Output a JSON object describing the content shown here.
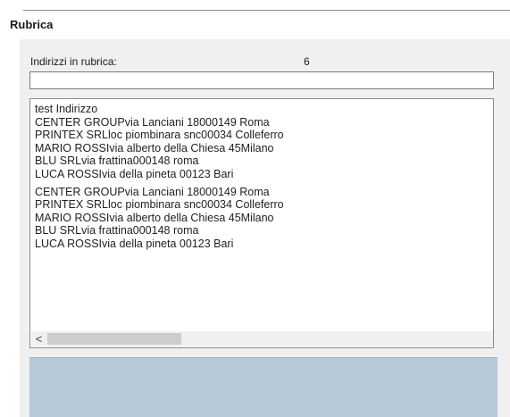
{
  "window": {
    "title": "Rubrica"
  },
  "address_count": {
    "label": "Indirizzi in rubrica:",
    "value": "6"
  },
  "search": {
    "value": ""
  },
  "address_list": {
    "items": [
      "test Indirizzo",
      "CENTER GROUPvia Lanciani 18000149 Roma",
      "PRINTEX SRLloc piombinara snc00034 Colleferro",
      "MARIO ROSSIvia alberto della Chiesa 45Milano",
      "BLU SRLvia frattina000148 roma",
      "LUCA ROSSIvia della pineta 00123 Bari",
      "CENTER GROUPvia Lanciani 18000149 Roma",
      "PRINTEX SRLloc piombinara snc00034 Colleferro",
      "MARIO ROSSIvia alberto della Chiesa 45Milano",
      "BLU SRLvia frattina000148 roma",
      "LUCA ROSSIvia della pineta 00123 Bari"
    ]
  },
  "scrollbar": {
    "left_arrow": "<"
  },
  "colors": {
    "client_background": "#f0f0f0",
    "bottom_panel": "#b7c9d9"
  }
}
